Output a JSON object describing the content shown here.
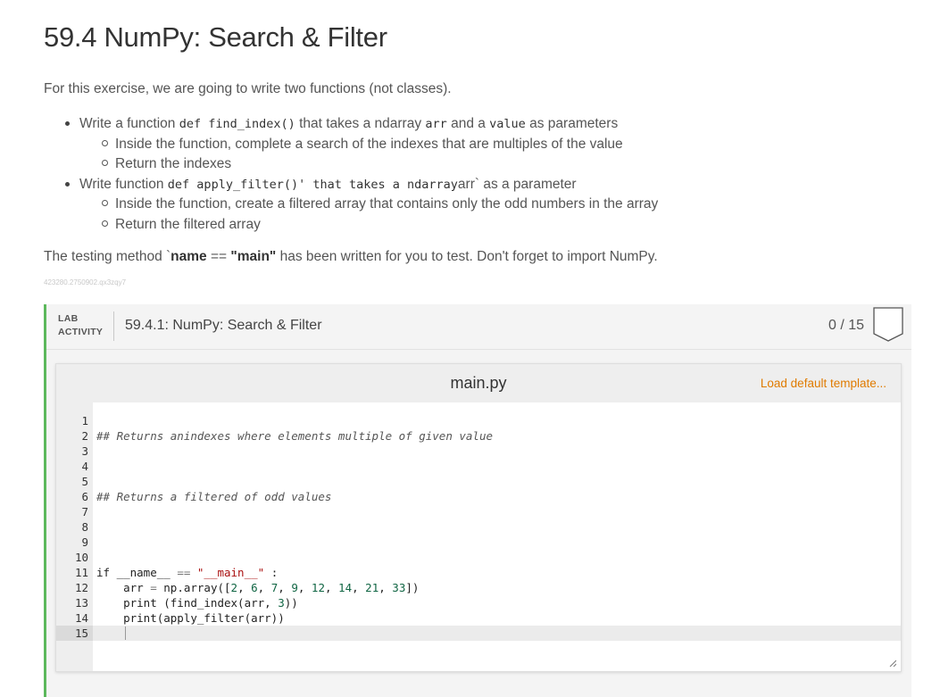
{
  "page": {
    "title": "59.4 NumPy: Search & Filter",
    "intro": "For this exercise, we are going to write two functions (not classes).",
    "tasks": [
      {
        "parts": [
          {
            "t": "Write a function ",
            "m": false
          },
          {
            "t": "def find_index()",
            "m": true
          },
          {
            "t": " that takes a ndarray ",
            "m": false
          },
          {
            "t": "arr",
            "m": true
          },
          {
            "t": " and a ",
            "m": false
          },
          {
            "t": "value",
            "m": true
          },
          {
            "t": " as parameters",
            "m": false
          }
        ],
        "subitems": [
          "Inside the function, complete a search of the indexes that are multiples of the value",
          "Return the indexes"
        ]
      },
      {
        "parts": [
          {
            "t": "Write function ",
            "m": false
          },
          {
            "t": "def apply_filter()' that takes a ndarray",
            "m": true
          },
          {
            "t": "arr` as a parameter",
            "m": false
          }
        ],
        "subitems": [
          "Inside the function, create a filtered array that contains only the odd numbers in the array",
          "Return the filtered array"
        ]
      }
    ],
    "testing_note": {
      "prefix": "The testing method `",
      "bold1": "name",
      "middle": " == ",
      "bold2": "\"main\"",
      "suffix": " has been written for you to test. Don't forget to import NumPy."
    },
    "tiny_id": "423280.2750902.qx3zqy7"
  },
  "lab": {
    "tag_line1": "LAB",
    "tag_line2": "ACTIVITY",
    "title": "59.4.1: NumPy: Search & Filter",
    "score": "0 / 15",
    "accent_color": "#5cb85c"
  },
  "editor": {
    "file_name": "main.py",
    "load_template": "Load default template...",
    "load_template_color": "#e07b00",
    "lines": [
      {
        "n": "1",
        "html": ""
      },
      {
        "n": "2",
        "html": "<span class=\"cm\">## Returns anindexes where elements multiple of given value</span>"
      },
      {
        "n": "3",
        "html": ""
      },
      {
        "n": "4",
        "html": ""
      },
      {
        "n": "5",
        "html": ""
      },
      {
        "n": "6",
        "html": "<span class=\"cm\">## Returns a filtered of odd values</span>"
      },
      {
        "n": "7",
        "html": ""
      },
      {
        "n": "8",
        "html": ""
      },
      {
        "n": "9",
        "html": ""
      },
      {
        "n": "10",
        "html": ""
      },
      {
        "n": "11",
        "html": "if __name__ <span class=\"op\">==</span> <span class=\"str\">\"__main__\"</span> :"
      },
      {
        "n": "12",
        "html": "    arr <span class=\"op\">=</span> np.array([<span class=\"num\">2</span>, <span class=\"num\">6</span>, <span class=\"num\">7</span>, <span class=\"num\">9</span>, <span class=\"num\">12</span>, <span class=\"num\">14</span>, <span class=\"num\">21</span>, <span class=\"num\">33</span>])"
      },
      {
        "n": "13",
        "html": "    print (find_index(arr, <span class=\"num\">3</span>))"
      },
      {
        "n": "14",
        "html": "    print(apply_filter(arr))"
      },
      {
        "n": "15",
        "html": ""
      }
    ],
    "active_line": 15
  }
}
